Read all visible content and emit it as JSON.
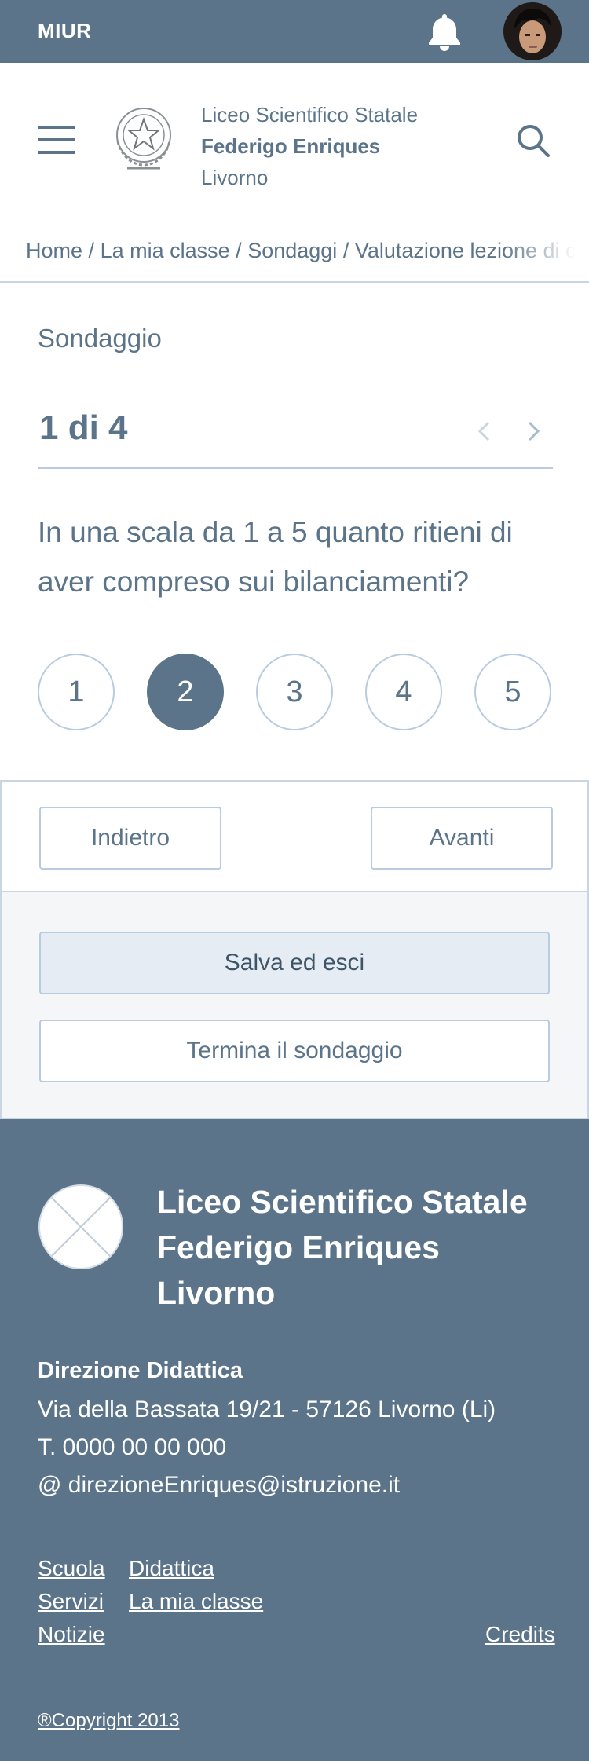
{
  "topbar": {
    "brand": "MIUR",
    "bell_icon": "bell-icon",
    "avatar": "user-avatar"
  },
  "header": {
    "menu_icon": "hamburger-menu-icon",
    "school_line1": "Liceo Scientifico Statale",
    "school_line2": "Federigo Enriques",
    "school_line3": "Livorno",
    "search_icon": "search-icon"
  },
  "breadcrumb": {
    "items": [
      "Home",
      "La mia classe",
      "Sondaggi",
      "Valutazione lezione di c"
    ],
    "separator": "/"
  },
  "survey": {
    "label": "Sondaggio",
    "counter": "1 di 4",
    "question": "In una scala da 1 a 5 quanto ritieni di aver compreso sui bilanciamenti?",
    "options": [
      "1",
      "2",
      "3",
      "4",
      "5"
    ],
    "selected": "2"
  },
  "navigation": {
    "back_label": "Indietro",
    "next_label": "Avanti"
  },
  "actions": {
    "save_label": "Salva ed esci",
    "end_label": "Termina il sondaggio"
  },
  "footer": {
    "school_line1": "Liceo Scientifico Statale",
    "school_line2": "Federigo Enriques",
    "school_line3": "Livorno",
    "direction_title": "Direzione Didattica",
    "address": "Via della Bassata 19/21 - 57126 Livorno (Li)",
    "phone": "T. 0000 00 00 000",
    "email": "@ direzioneEnriques@istruzione.it",
    "links": {
      "scuola": "Scuola",
      "didattica": "Didattica",
      "servizi": "Servizi",
      "mia_classe": "La mia classe",
      "notizie": "Notizie",
      "credits": "Credits"
    },
    "copyright": "®Copyright 2013"
  },
  "colors": {
    "primary": "#5b7489",
    "border": "#b9cbe0",
    "save_bg": "#e5ecf3",
    "panel_bg": "#f5f6f7"
  }
}
